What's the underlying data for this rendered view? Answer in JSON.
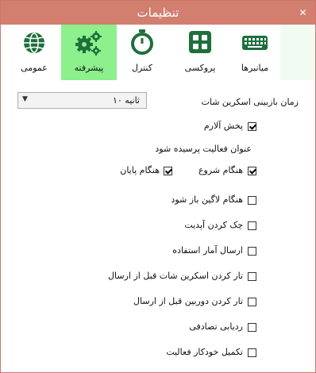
{
  "window": {
    "title": "تنظیمات",
    "close": "✕"
  },
  "tabs": [
    {
      "label": "میانبرها",
      "icon": "keyboard-icon",
      "active": false
    },
    {
      "label": "پروکسی",
      "icon": "grid-icon",
      "active": false
    },
    {
      "label": "کنترل",
      "icon": "stopwatch-icon",
      "active": false
    },
    {
      "label": "پیشرفته",
      "icon": "gears-icon",
      "active": true
    },
    {
      "label": "عمومی",
      "icon": "globe-icon",
      "active": false
    }
  ],
  "screenshot_interval": {
    "label": "زمان بازبینی اسکرین شات",
    "value": "۱۰ ثانیه"
  },
  "alarm": {
    "label": "پخش آلارم",
    "checked": true
  },
  "activity_question": {
    "label": "عنوان فعالیت پرسیده شود"
  },
  "on_start": {
    "label": "هنگام شروع",
    "checked": true
  },
  "on_end": {
    "label": "هنگام پایان",
    "checked": true
  },
  "options": [
    {
      "label": "هنگام لاگین باز شود",
      "checked": false
    },
    {
      "label": "چک کردن آپدیت",
      "checked": false
    },
    {
      "label": "ارسال آمار استفاده",
      "checked": false
    },
    {
      "label": "تار کردن اسکرین شات قبل از ارسال",
      "checked": false
    },
    {
      "label": "تار کردن دوربین قبل از ارسال",
      "checked": false
    },
    {
      "label": "ردیابی تصادفی",
      "checked": false
    },
    {
      "label": "تکمیل خودکار فعالیت",
      "checked": false
    }
  ],
  "colors": {
    "titlebar": "#d27f70",
    "accent": "#1e6f3c",
    "active_tab": "#8cf08c"
  }
}
